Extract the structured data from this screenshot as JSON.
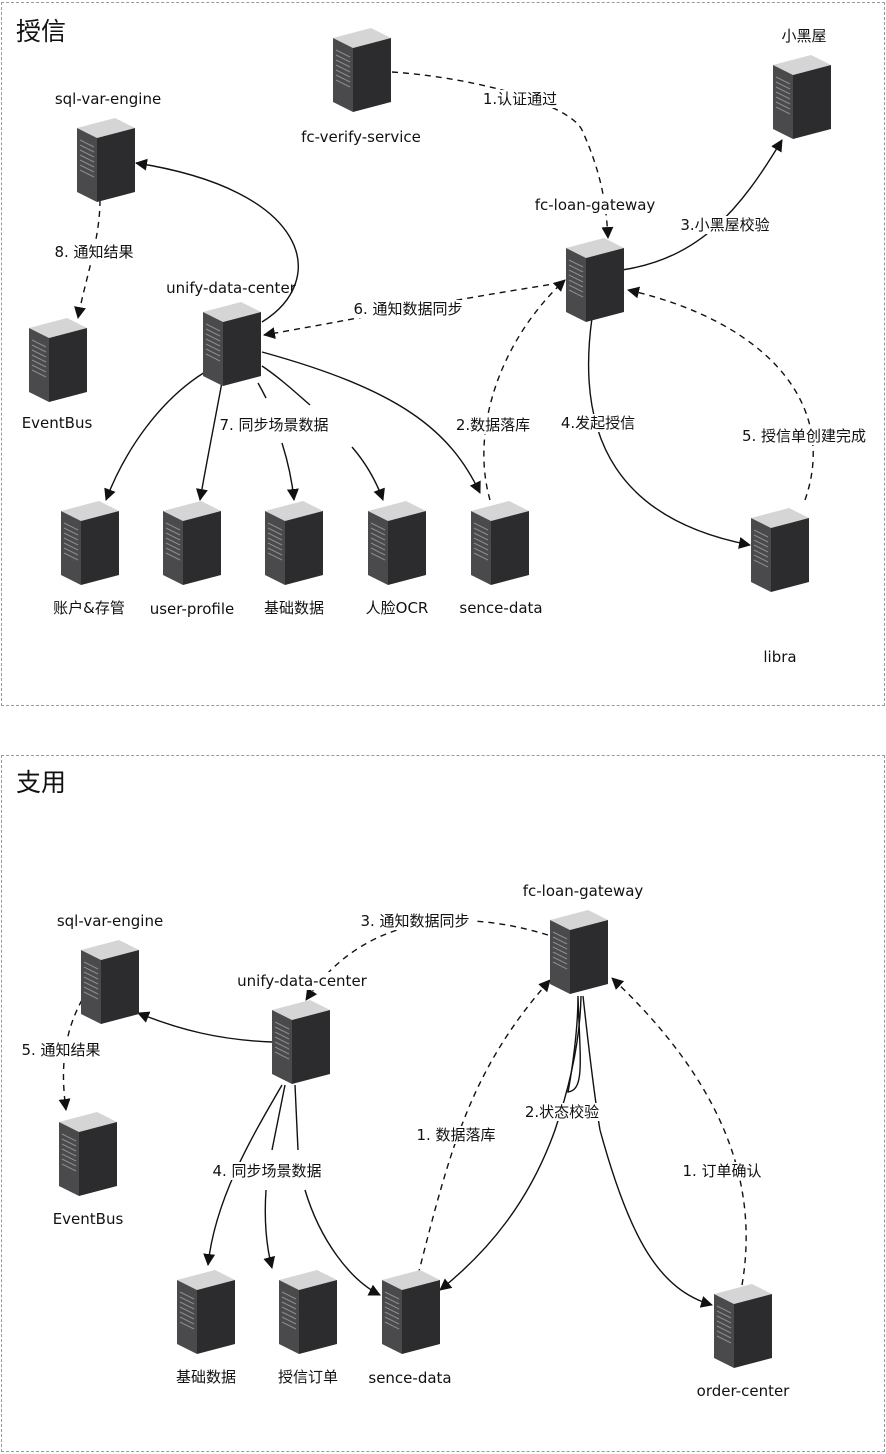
{
  "section_credit": {
    "title": "授信",
    "nodes": {
      "fc_verify_service": "fc-verify-service",
      "fc_loan_gateway": "fc-loan-gateway",
      "xiaoheiwu": "小黑屋",
      "sql_var_engine": "sql-var-engine",
      "unify_data_center": "unify-data-center",
      "eventbus": "EventBus",
      "account": "账户&存管",
      "user_profile": "user-profile",
      "base_data": "基础数据",
      "face_ocr": "人脸OCR",
      "sence_data": "sence-data",
      "libra": "libra"
    },
    "edges": {
      "e1": "1.认证通过",
      "e2": "2.数据落库",
      "e3": "3.小黑屋校验",
      "e4": "4.发起授信",
      "e5": "5. 授信单创建完成",
      "e6": "6. 通知数据同步",
      "e7": "7. 同步场景数据",
      "e8": "8. 通知结果"
    }
  },
  "section_use": {
    "title": "支用",
    "nodes": {
      "fc_loan_gateway": "fc-loan-gateway",
      "sql_var_engine": "sql-var-engine",
      "unify_data_center": "unify-data-center",
      "eventbus": "EventBus",
      "base_data": "基础数据",
      "credit_order": "授信订单",
      "sence_data": "sence-data",
      "order_center": "order-center"
    },
    "edges": {
      "e1a": "1. 数据落库",
      "e1b": "1. 订单确认",
      "e2": "2.状态校验",
      "e3": "3. 通知数据同步",
      "e4": "4. 同步场景数据",
      "e5": "5. 通知结果"
    }
  },
  "colors": {
    "server_front": "#3d3d3f",
    "server_side": "#2a2a2c",
    "server_top": "#d8d8d8",
    "border": "#9a9a9a",
    "line": "#111111"
  },
  "icons": {
    "node": "server-tower-icon"
  }
}
